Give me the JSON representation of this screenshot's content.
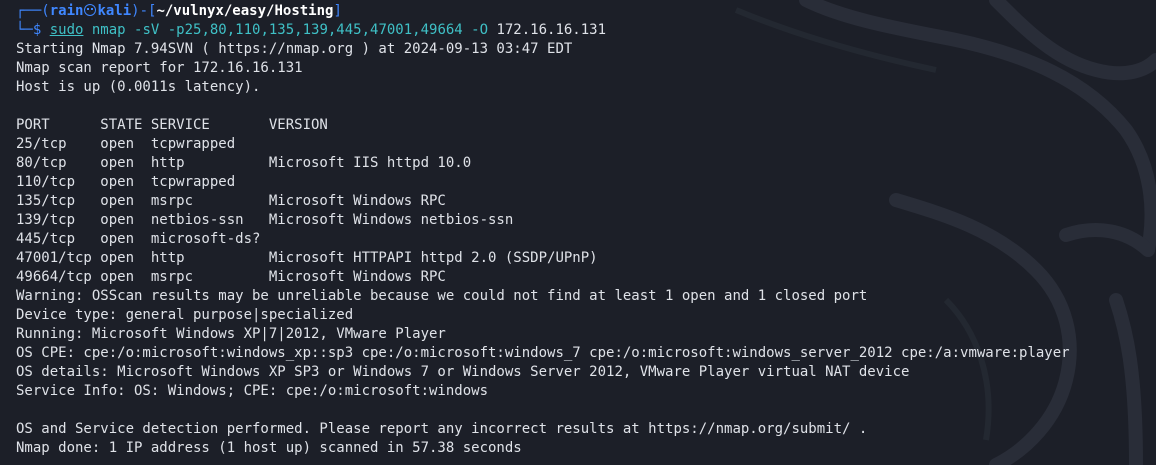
{
  "prompt": {
    "open": "┌──(",
    "user": "rain",
    "separator_icon": "kali-skull-icon",
    "host": "kali",
    "mid": ")-[",
    "path": "~/vulnyx/easy/Hosting",
    "close": "]",
    "second_prefix": "└─$ ",
    "cmd_sudo": "sudo",
    "cmd_args": " nmap -sV -p25,80,110,135,139,445,47001,49664 -O ",
    "cmd_target": "172.16.16.131"
  },
  "colors": {
    "background": "#1c1f28",
    "prompt_blue": "#3f87ff",
    "command_cyan": "#3fc0c6",
    "text": "#dfe2e8"
  },
  "output_lines": [
    "Starting Nmap 7.94SVN ( https://nmap.org ) at 2024-09-13 03:47 EDT",
    "Nmap scan report for 172.16.16.131",
    "Host is up (0.0011s latency).",
    "",
    "PORT      STATE SERVICE       VERSION",
    "25/tcp    open  tcpwrapped",
    "80/tcp    open  http          Microsoft IIS httpd 10.0",
    "110/tcp   open  tcpwrapped",
    "135/tcp   open  msrpc         Microsoft Windows RPC",
    "139/tcp   open  netbios-ssn   Microsoft Windows netbios-ssn",
    "445/tcp   open  microsoft-ds?",
    "47001/tcp open  http          Microsoft HTTPAPI httpd 2.0 (SSDP/UPnP)",
    "49664/tcp open  msrpc         Microsoft Windows RPC",
    "Warning: OSScan results may be unreliable because we could not find at least 1 open and 1 closed port",
    "Device type: general purpose|specialized",
    "Running: Microsoft Windows XP|7|2012, VMware Player",
    "OS CPE: cpe:/o:microsoft:windows_xp::sp3 cpe:/o:microsoft:windows_7 cpe:/o:microsoft:windows_server_2012 cpe:/a:vmware:player",
    "OS details: Microsoft Windows XP SP3 or Windows 7 or Windows Server 2012, VMware Player virtual NAT device",
    "Service Info: OS: Windows; CPE: cpe:/o:microsoft:windows",
    "",
    "OS and Service detection performed. Please report any incorrect results at https://nmap.org/submit/ .",
    "Nmap done: 1 IP address (1 host up) scanned in 57.38 seconds"
  ]
}
